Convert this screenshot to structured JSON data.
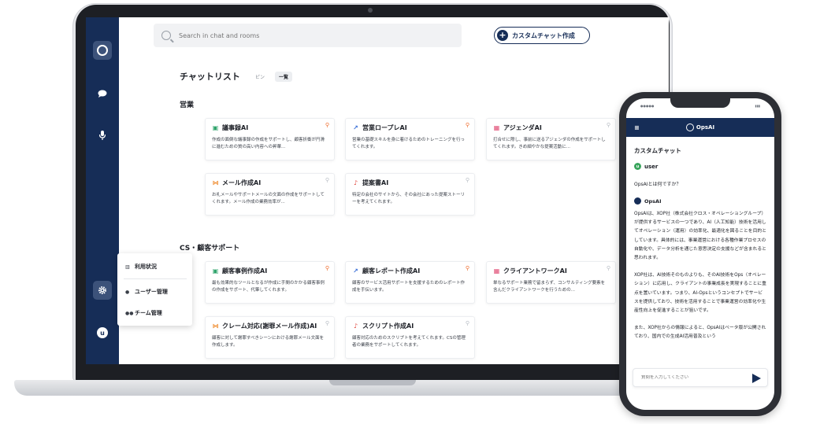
{
  "search": {
    "placeholder": "Search in chat and rooms"
  },
  "custom_chat_button": "カスタムチャット作成",
  "chat_list": {
    "title": "チャットリスト",
    "tab_pin": "ピン",
    "tab_all": "一覧"
  },
  "sections": [
    {
      "title": "営業",
      "cards": [
        {
          "icon": "note-icon",
          "icon_char": "▣",
          "icon_color": "#2fa36b",
          "title": "議事録AI",
          "desc": "作成の面倒な議事録の作成をサポートし、顧客折衝が円滑に進むための質の高い内容への昇華...",
          "pinned": true
        },
        {
          "icon": "chart-line-icon",
          "icon_char": "↗",
          "icon_color": "#3a6fd8",
          "title": "営業ロープレAI",
          "desc": "営業の基礎スキルを身に着けるためのトレーニングを行ってくれます。",
          "pinned": true
        },
        {
          "icon": "calendar-icon",
          "icon_char": "▦",
          "icon_color": "#e04a73",
          "title": "アジェンダAI",
          "desc": "打合せに際し、事前に送るアジェンダの作成をサポートしてくれます。きめ細やかな提案活動に...",
          "pinned": false
        },
        {
          "icon": "antenna-icon",
          "icon_char": "⋈",
          "icon_color": "#ef8a2c",
          "title": "メール作成AI",
          "desc": "お礼メールやサポートメールの文面の作成をサポートしてくれます。メール作成の業務効率が...",
          "pinned": false
        },
        {
          "icon": "bell-icon",
          "icon_char": "♪",
          "icon_color": "#e0443b",
          "title": "提案書AI",
          "desc": "特定の会社のサイトから、その会社にあった提案ストーリーを考えてくれます。",
          "pinned": false
        }
      ]
    },
    {
      "title": "CS・顧客サポート",
      "cards": [
        {
          "icon": "note-icon",
          "icon_char": "▣",
          "icon_color": "#2fa36b",
          "title": "顧客事例作成AI",
          "desc": "最も効果的なツールとなるが作成に手間のかかる顧客事例の作成をサポート、代筆してくれます。",
          "pinned": true
        },
        {
          "icon": "chart-line-icon",
          "icon_char": "↗",
          "icon_color": "#3a6fd8",
          "title": "顧客レポート作成AI",
          "desc": "顧客のサービス活用サポートを支援するためのレポート作成を手伝います。",
          "pinned": true
        },
        {
          "icon": "calendar-icon",
          "icon_char": "▦",
          "icon_color": "#e04a73",
          "title": "クライアントワークAI",
          "desc": "単なるサポート業務で留まらず、コンサルティング要素を含んだクライアントワークを行うための...",
          "pinned": false
        },
        {
          "icon": "antenna-icon",
          "icon_char": "⋈",
          "icon_color": "#ef8a2c",
          "title": "クレーム対応(謝罪メール作成)AI",
          "desc": "顧客に対して謝罪すべきシーンにおける謝罪メール文面を作成します。",
          "pinned": false
        },
        {
          "icon": "bell-icon",
          "icon_char": "♪",
          "icon_color": "#e0443b",
          "title": "スクリプト作成AI",
          "desc": "顧客対応のためのスクリプトを考えてくれます。CSの管理者の業務をサポートしてくれます。",
          "pinned": false
        }
      ]
    }
  ],
  "settings_menu": {
    "usage": "利用状況",
    "user_mgmt": "ユーザー管理",
    "team_mgmt": "チーム管理"
  },
  "sidebar": {
    "avatar_letter": "u"
  },
  "phone": {
    "brand": "OpsAI",
    "page_title": "カスタムチャット",
    "user_name": "user",
    "user_letter": "u",
    "question": "OpsAIとは何ですか？",
    "bot_name": "OpsAI",
    "answer_p1": "OpsAIは、XOP社（株式会社クロス・オペレーショングループ）が提供するサービスの一つであり、AI（人工知能）技術を活用してオペレーション（運用）の効率化、最適化を図ることを目的としています。具体的には、事業運営における各種作業プロセスの自動化や、データ分析を通じた意思決定の支援などが含まれると思われます。",
    "answer_p2": "XOP社は、AI技術そのものよりも、そのAI技術をOps（オペレーション）に応用し、クライアントの事業成長を実現することに重点を置いています。つまり、AI-Opsというコンセプトでサービスを提供しており、技術を活用することで事業運営の効率化や生産性向上を促進することが狙いです。",
    "answer_p3": "また、XOP社からの情報によると、OpsAIはベータ版が公開されており、国内での生成AI活用普及という",
    "input_placeholder": "質問を入力してください"
  }
}
